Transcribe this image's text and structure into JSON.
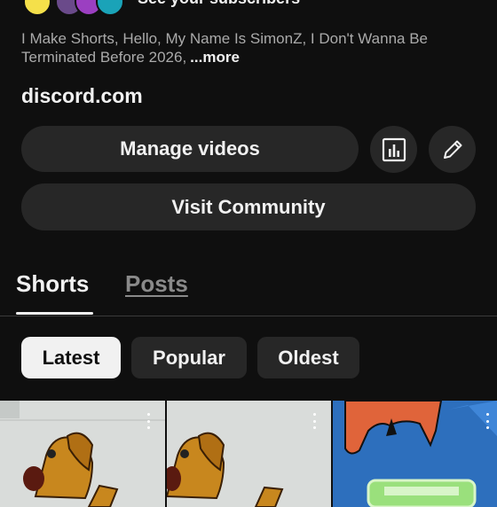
{
  "header": {
    "subscribers_link": "See your subscribers"
  },
  "description": {
    "text": "I Make Shorts, Hello, My Name Is SimonZ, I Don't Wanna Be Terminated Before 2026,",
    "more_label": "...more"
  },
  "channel_link": "discord.com",
  "actions": {
    "manage_videos_label": "Manage videos",
    "analytics_icon": "bar-chart-icon",
    "edit_icon": "pencil-icon",
    "visit_community_label": "Visit Community"
  },
  "tabs": [
    {
      "label": "Shorts",
      "selected": true
    },
    {
      "label": "Posts",
      "selected": false
    }
  ],
  "filters": [
    {
      "label": "Latest",
      "selected": true
    },
    {
      "label": "Popular",
      "selected": false
    },
    {
      "label": "Oldest",
      "selected": false
    }
  ],
  "colors": {
    "background": "#0f0f0f",
    "button": "#272727",
    "text": "#f1f1f1",
    "muted_text": "#aaaaaa"
  }
}
